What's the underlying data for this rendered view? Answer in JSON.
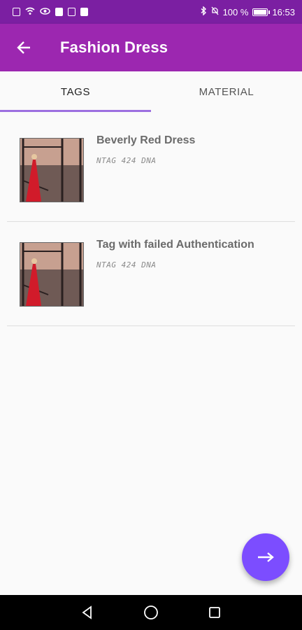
{
  "status_bar": {
    "battery_text": "100 %",
    "time": "16:53"
  },
  "app_bar": {
    "title": "Fashion Dress",
    "back_icon": "arrow-left-icon"
  },
  "tabs": [
    {
      "label": "TAGS",
      "active": true
    },
    {
      "label": "MATERIAL",
      "active": false
    }
  ],
  "items": [
    {
      "title": "Beverly Red Dress",
      "subtitle": "NTAG 424 DNA",
      "image": "red-dress-photo"
    },
    {
      "title": "Tag with failed Authentication",
      "subtitle": "NTAG 424 DNA",
      "image": "red-dress-photo"
    }
  ],
  "fab": {
    "icon": "arrow-right-icon"
  },
  "colors": {
    "status_bar": "#7b1fa2",
    "app_bar": "#9c27b0",
    "tab_indicator": "#9c6fe0",
    "fab": "#7c4dff"
  },
  "nav": [
    "back-triangle-icon",
    "home-circle-icon",
    "recents-square-icon"
  ]
}
